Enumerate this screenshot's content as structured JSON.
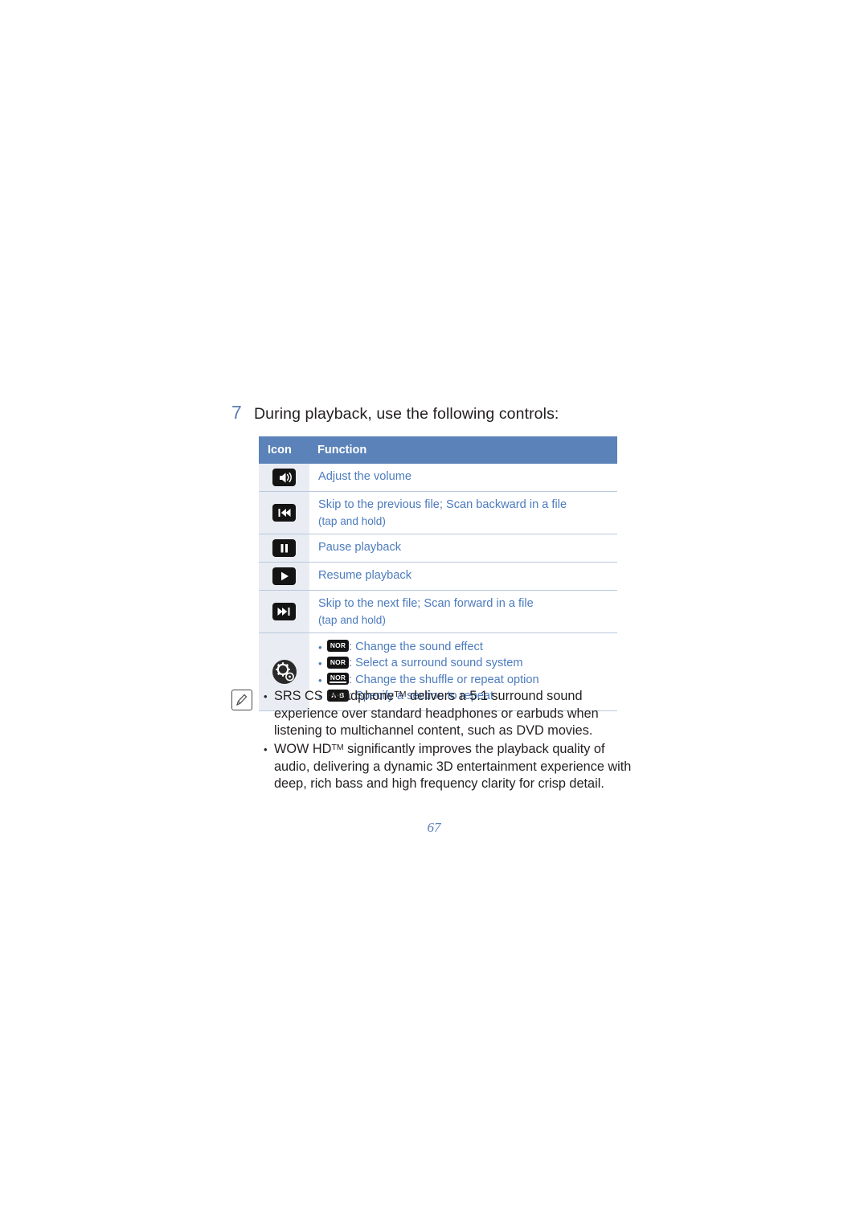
{
  "step": {
    "number": "7",
    "text": "During playback, use the following controls:"
  },
  "table": {
    "headers": {
      "icon": "Icon",
      "function": "Function"
    },
    "rows": [
      {
        "icon_name": "volume-icon",
        "function": "Adjust the volume",
        "sub": ""
      },
      {
        "icon_name": "skip-previous-icon",
        "function": "Skip to the previous file; Scan backward in a file",
        "sub": "(tap and hold)"
      },
      {
        "icon_name": "pause-icon",
        "function": "Pause playback",
        "sub": ""
      },
      {
        "icon_name": "play-icon",
        "function": "Resume playback",
        "sub": ""
      },
      {
        "icon_name": "skip-next-icon",
        "function": "Skip to the next file; Scan forward in a file",
        "sub": "(tap and hold)"
      }
    ],
    "settings_row": {
      "icon_name": "settings-gear-icon",
      "items": [
        {
          "badge": "NOR",
          "badge_style": "plain",
          "text": ": Change the sound effect"
        },
        {
          "badge": "NOR",
          "badge_style": "plain",
          "text": ": Select a surround sound system"
        },
        {
          "badge": "NOR",
          "badge_style": "bar",
          "text": ": Change the shuffle or repeat option"
        },
        {
          "badge": "A·B",
          "badge_style": "ab",
          "text": ": Specify a section to repeat"
        }
      ]
    }
  },
  "note": {
    "icon_name": "note-pencil-icon",
    "items": [
      {
        "prefix": "SRS CS Headphone",
        "tm": "TM",
        "rest": " delivers a 5.1 surround sound experience over standard headphones or earbuds when listening to multichannel content, such as DVD movies."
      },
      {
        "prefix": "WOW HD",
        "tm": "TM",
        "rest": " significantly improves the playback quality of audio, delivering a dynamic 3D entertainment experience with deep, rich bass and high frequency clarity for crisp detail."
      }
    ]
  },
  "page_number": "67",
  "colors": {
    "header_bg": "#5b83b9",
    "link_blue": "#4c7bbd",
    "icon_cell_bg": "#e9edf3",
    "body_text": "#231f20"
  }
}
